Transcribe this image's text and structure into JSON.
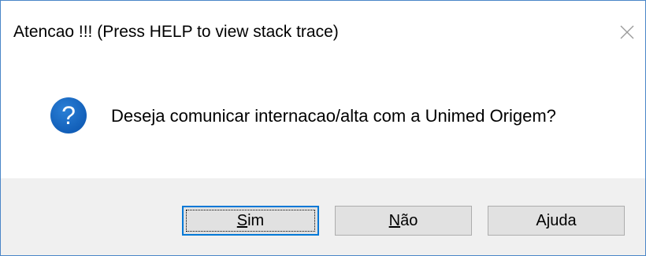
{
  "dialog": {
    "title": "Atencao !!! (Press HELP to view stack trace)",
    "message": "Deseja comunicar internacao/alta com a Unimed Origem?",
    "icon": "question-icon",
    "accent_color": "#1565c0"
  },
  "buttons": {
    "yes": {
      "mnemonic": "S",
      "rest": "im"
    },
    "no": {
      "mnemonic": "N",
      "rest": "ão"
    },
    "help": {
      "label": "Ajuda"
    }
  }
}
